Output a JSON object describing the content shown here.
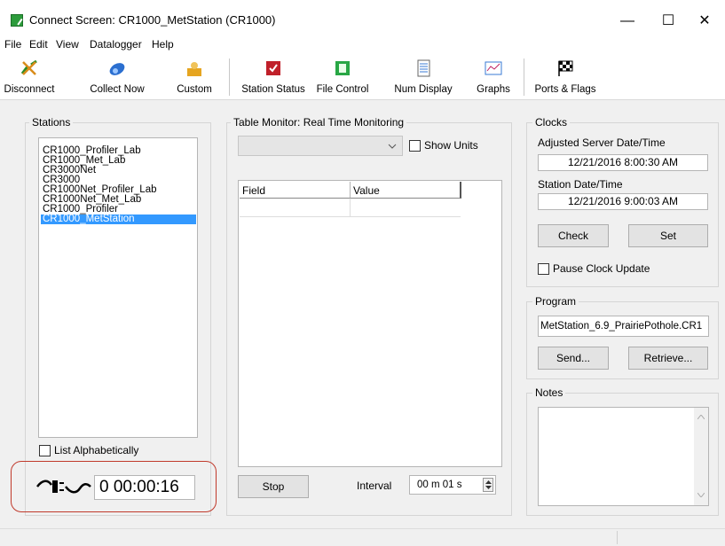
{
  "window": {
    "title": "Connect Screen: CR1000_MetStation (CR1000)",
    "minimize": "—",
    "maximize": "☐",
    "close": "✕"
  },
  "menu": {
    "file": "File",
    "edit": "Edit",
    "view": "View",
    "datalogger": "Datalogger",
    "help": "Help"
  },
  "toolbar": {
    "disconnect": "Disconnect",
    "collect_now": "Collect Now",
    "custom": "Custom",
    "station_status": "Station Status",
    "file_control": "File Control",
    "num_display": "Num Display",
    "graphs": "Graphs",
    "ports_flags": "Ports & Flags"
  },
  "stations": {
    "title": "Stations",
    "items": [
      "CR1000_Profiler_Lab",
      "CR1000_Met_Lab",
      "CR3000Net",
      "CR3000",
      "CR1000Net_Profiler_Lab",
      "CR1000Net_Met_Lab",
      "CR1000_Profiler",
      "CR1000_MetStation"
    ],
    "selected_index": 7,
    "list_alphabetically": "List Alphabetically",
    "elapsed_time": "0 00:00:16"
  },
  "table_monitor": {
    "title": "Table Monitor: Real Time Monitoring",
    "table_select": "",
    "show_units": "Show Units",
    "columns": [
      "Field",
      "Value"
    ],
    "stop": "Stop",
    "interval_label": "Interval",
    "interval_value": "00 m 01 s"
  },
  "clocks": {
    "title": "Clocks",
    "server_label": "Adjusted Server Date/Time",
    "server_value": "12/21/2016 8:00:30 AM",
    "station_label": "Station Date/Time",
    "station_value": "12/21/2016 9:00:03 AM",
    "check": "Check",
    "set": "Set",
    "pause": "Pause Clock Update"
  },
  "program": {
    "title": "Program",
    "name": "MetStation_6.9_PrairiePothole.CR1",
    "send": "Send...",
    "retrieve": "Retrieve..."
  },
  "notes": {
    "title": "Notes",
    "text": ""
  },
  "colors": {
    "selection": "#3399ff",
    "highlight_ring": "#c0392b"
  }
}
